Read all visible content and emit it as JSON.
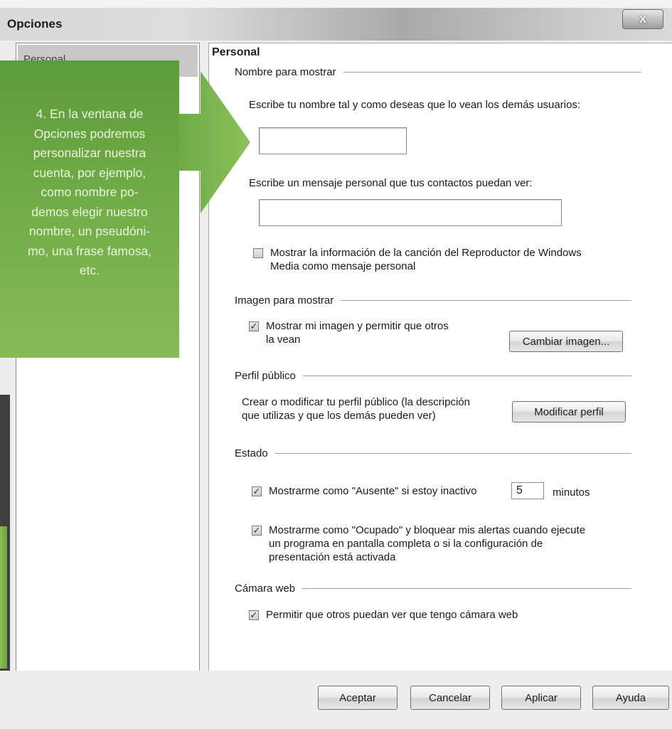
{
  "window": {
    "title": "Opciones",
    "close_label": "X"
  },
  "nav": {
    "selected_item": "Personal"
  },
  "callout": {
    "text": "4. En la ventana de\nOpciones podremos\npersonalizar nuestra\ncuenta, por ejemplo,\ncomo nombre po-\ndemos elegir nuestro\nnombre, un pseudóni-\nmo, una frase famosa,\netc.",
    "color": "#6eaa44"
  },
  "personal": {
    "title": "Personal",
    "display_name": {
      "header": "Nombre para mostrar",
      "name_prompt": "Escribe tu nombre tal y como deseas que lo vean los demás usuarios:",
      "name_value": "",
      "message_prompt": "Escribe un mensaje personal que tus contactos puedan ver:",
      "message_value": "",
      "media_checkbox": {
        "label_line1": "Mostrar la información de la canción del Reproductor de Windows",
        "label_line2": "Media como mensaje personal",
        "checked": false
      }
    },
    "display_picture": {
      "header": "Imagen para mostrar",
      "checkbox": {
        "label_line1": "Mostrar mi imagen y permitir que otros",
        "label_line2": "la vean",
        "checked": true
      },
      "change_button": "Cambiar imagen..."
    },
    "public_profile": {
      "header": "Perfil público",
      "description_line1": "Crear o modificar tu perfil público (la descripción",
      "description_line2": "que utilizas y que los demás pueden ver)",
      "edit_button": "Modificar perfil"
    },
    "status": {
      "header": "Estado",
      "away": {
        "label": "Mostrarme como \"Ausente\" si estoy inactivo",
        "minutes": "5",
        "minutes_label": "minutos",
        "checked": true
      },
      "busy": {
        "label_line1": "Mostrarme como \"Ocupado\" y bloquear mis alertas cuando ejecute",
        "label_line2": "un programa en pantalla completa o si la configuración de",
        "label_line3": "presentación está activada",
        "checked": true
      }
    },
    "webcam": {
      "header": "Cámara web",
      "checkbox": {
        "label": "Permitir que otros puedan ver que tengo cámara web",
        "checked": true
      }
    }
  },
  "footer": {
    "ok": "Aceptar",
    "cancel": "Cancelar",
    "apply": "Aplicar",
    "help": "Ayuda"
  },
  "check_mark": "✓"
}
